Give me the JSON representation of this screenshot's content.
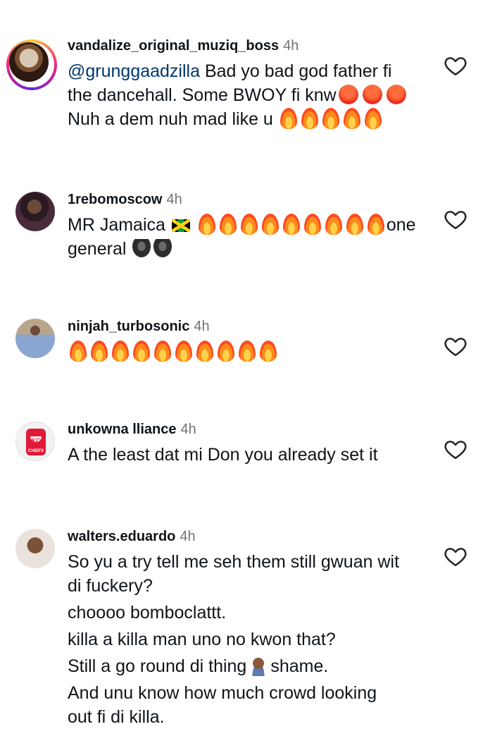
{
  "comments": [
    {
      "username": "vandalize_original_muziq_boss",
      "time": "4h",
      "mention": "@grunggaadzilla",
      "line1": " Bad yo bad god father fi",
      "line2": "the dancehall. Some BWOY fi knw",
      "line3": "Nuh a dem nuh mad like u"
    },
    {
      "username": "1rebomoscow",
      "time": "4h",
      "text_start": "MR Jamaica",
      "text_end": "one",
      "line2": "general"
    },
    {
      "username": "ninjah_turbosonic",
      "time": "4h"
    },
    {
      "username": "unkowna lliance",
      "time": "4h",
      "text": "A the least dat mi Don you already set it"
    },
    {
      "username": "walters.eduardo",
      "time": "4h",
      "lines": [
        "So yu a try tell me seh them still gwuan wit",
        "di fuckery?",
        "choooo bomboclattt.",
        "killa a killa man uno no kwon that?",
        "Still a go round di thing",
        "shame.",
        "And unu know how much crowd looking",
        "out fi di killa."
      ]
    }
  ],
  "avatar_badge_text": "CHIEFS",
  "icons": {
    "like": "heart-outline-icon",
    "flag": "jamaica-flag-emoji",
    "fire": "fire-emoji",
    "angry": "angry-face-emoji",
    "gorilla": "gorilla-emoji",
    "facepalm": "facepalm-emoji"
  },
  "colors": {
    "mention": "#00376b",
    "meta": "#737373",
    "text": "#0f1419"
  }
}
